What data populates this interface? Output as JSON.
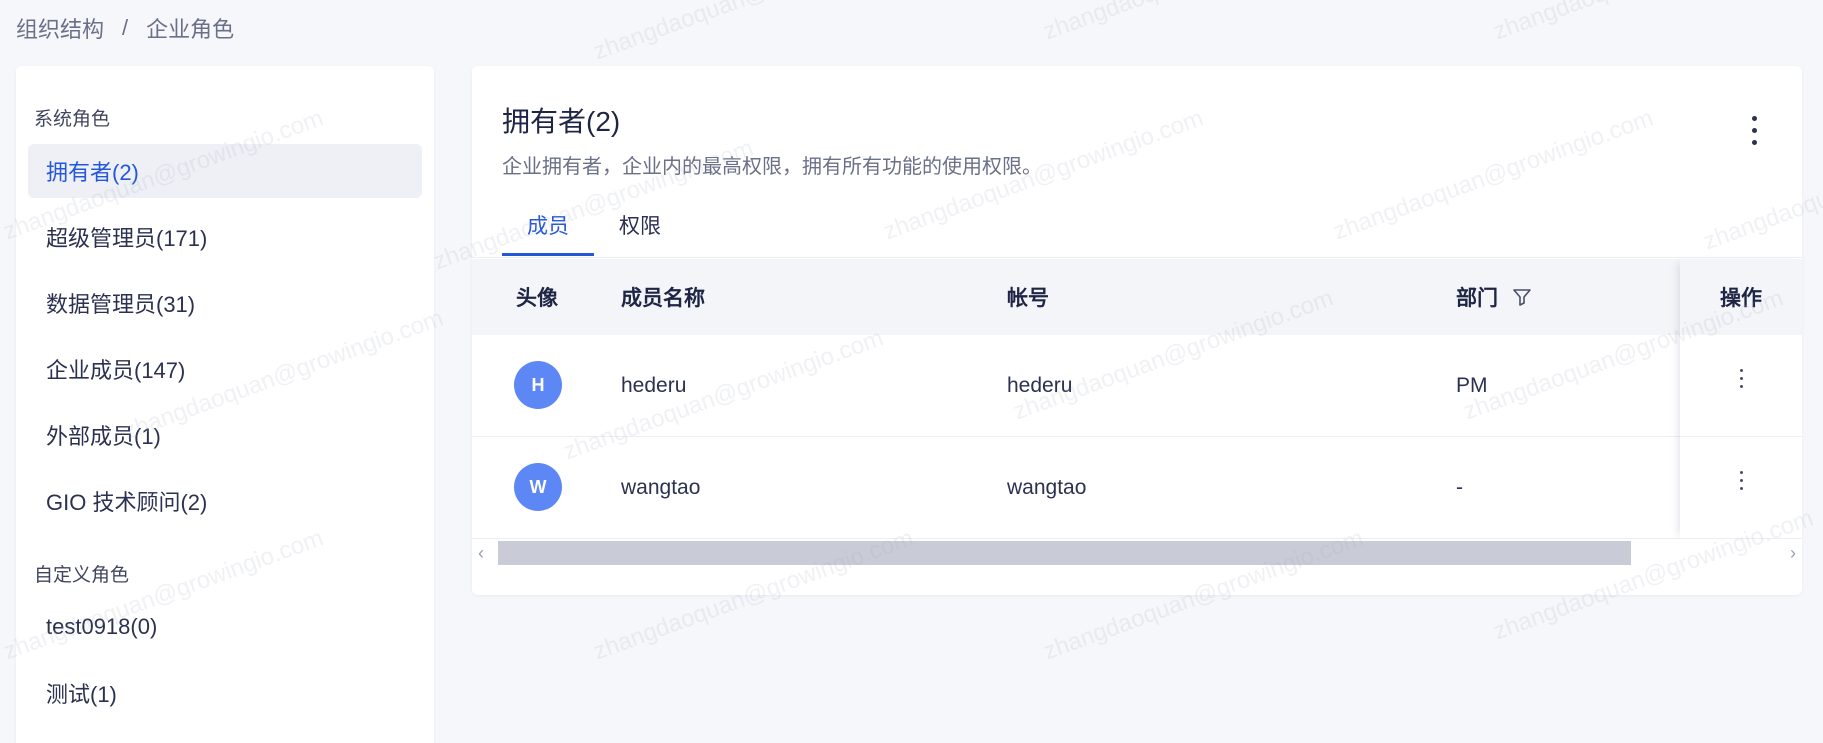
{
  "breadcrumb": {
    "parent": "组织结构",
    "separator": "/",
    "current": "企业角色"
  },
  "sidebar": {
    "system_title": "系统角色",
    "system_roles": [
      "拥有者(2)",
      "超级管理员(171)",
      "数据管理员(31)",
      "企业成员(147)",
      "外部成员(1)",
      "GIO 技术顾问(2)"
    ],
    "custom_title": "自定义角色",
    "custom_roles": [
      "test0918(0)",
      "测试(1)"
    ],
    "active_index": 0
  },
  "detail": {
    "title": "拥有者(2)",
    "description": "企业拥有者，企业内的最高权限，拥有所有功能的使用权限。",
    "more_icon": "more-vertical-icon",
    "tabs": [
      "成员",
      "权限"
    ],
    "active_tab": 0
  },
  "table": {
    "headers": {
      "avatar": "头像",
      "name": "成员名称",
      "account": "帐号",
      "department": "部门",
      "actions": "操作"
    },
    "filter_icon": "filter-icon",
    "rows": [
      {
        "initial": "H",
        "name": "hederu",
        "account": "hederu",
        "department": "PM"
      },
      {
        "initial": "W",
        "name": "wangtao",
        "account": "wangtao",
        "department": "-"
      }
    ],
    "scroll_left": "‹",
    "scroll_right": "›"
  },
  "watermark": "zhangdaoquan@growingio.com",
  "colors": {
    "accent": "#2458d8",
    "avatar": "#5e87f6",
    "active_bg": "#eef0f6",
    "page_bg": "#f6f7fb"
  }
}
